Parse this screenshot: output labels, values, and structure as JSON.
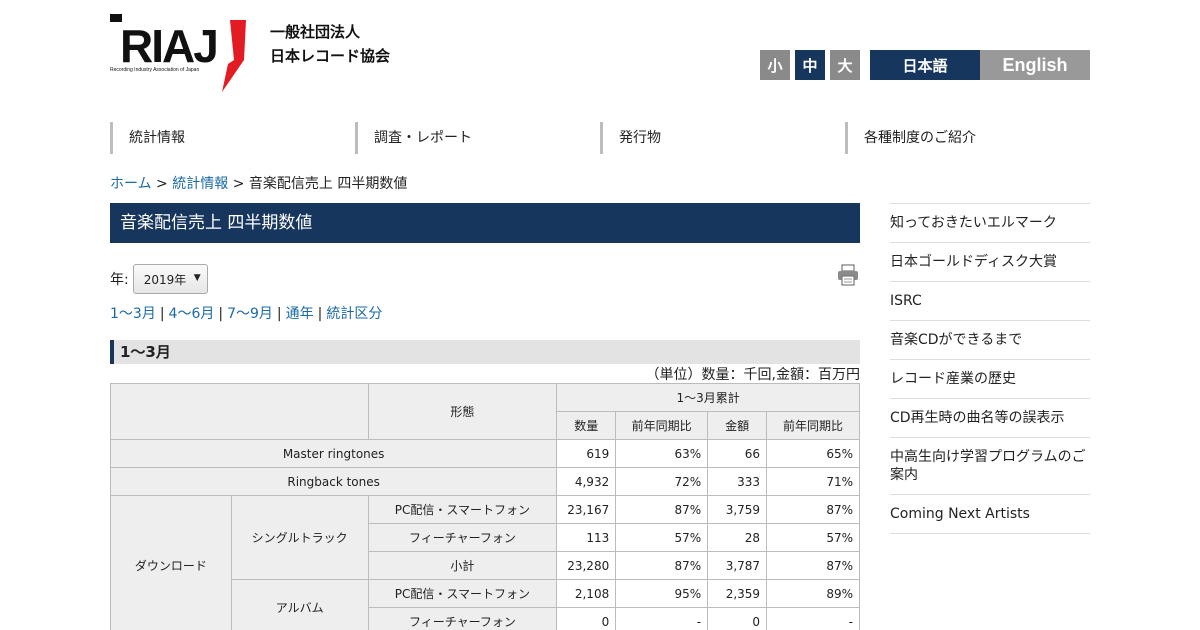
{
  "header": {
    "logo_text": "RIAJ",
    "logo_tagline": "Recording Industry Association of Japan",
    "org_line1": "一般社団法人",
    "org_line2": "日本レコード協会",
    "font_sizes": [
      "小",
      "中",
      "大"
    ],
    "languages": [
      "日本語",
      "English"
    ]
  },
  "nav": [
    "統計情報",
    "調査・レポート",
    "発行物",
    "各種制度のご紹介"
  ],
  "breadcrumb": {
    "home": "ホーム",
    "sep": ">",
    "stats": "統計情報",
    "current": "音楽配信売上 四半期数値"
  },
  "page_title": "音楽配信売上 四半期数値",
  "year_label": "年:",
  "year_value": "2019年",
  "quarter_links": [
    "1～3月",
    "4～6月",
    "7～9月",
    "通年",
    "統計区分"
  ],
  "section_title": "1～3月",
  "unit_note": "（単位）数量：千回,金額：百万円",
  "table": {
    "header_type": "形態",
    "header_period": "1～3月累計",
    "header_qty": "数量",
    "header_qty_yoy": "前年同期比",
    "header_amt": "金額",
    "header_amt_yoy": "前年同期比",
    "row_master": {
      "label": "Master ringtones",
      "qty": "619",
      "qty_yoy": "63%",
      "amt": "66",
      "amt_yoy": "65%"
    },
    "row_ringback": {
      "label": "Ringback tones",
      "qty": "4,932",
      "qty_yoy": "72%",
      "amt": "333",
      "amt_yoy": "71%"
    },
    "group_download": "ダウンロード",
    "sub_single": "シングルトラック",
    "single_pc": {
      "label": "PC配信・スマートフォン",
      "qty": "23,167",
      "qty_yoy": "87%",
      "amt": "3,759",
      "amt_yoy": "87%"
    },
    "single_fp": {
      "label": "フィーチャーフォン",
      "qty": "113",
      "qty_yoy": "57%",
      "amt": "28",
      "amt_yoy": "57%"
    },
    "single_sub": {
      "label": "小計",
      "qty": "23,280",
      "qty_yoy": "87%",
      "amt": "3,787",
      "amt_yoy": "87%"
    },
    "sub_album": "アルバム",
    "album_pc": {
      "label": "PC配信・スマートフォン",
      "qty": "2,108",
      "qty_yoy": "95%",
      "amt": "2,359",
      "amt_yoy": "89%"
    },
    "album_fp": {
      "label": "フィーチャーフォン",
      "qty": "0",
      "qty_yoy": "-",
      "amt": "0",
      "amt_yoy": "-"
    }
  },
  "sidebar": [
    "知っておきたいエルマーク",
    "日本ゴールドディスク大賞",
    "ISRC",
    "音楽CDができるまで",
    "レコード産業の歴史",
    "CD再生時の曲名等の誤表示",
    "中高生向け学習プログラムのご案内",
    "Coming Next Artists"
  ]
}
